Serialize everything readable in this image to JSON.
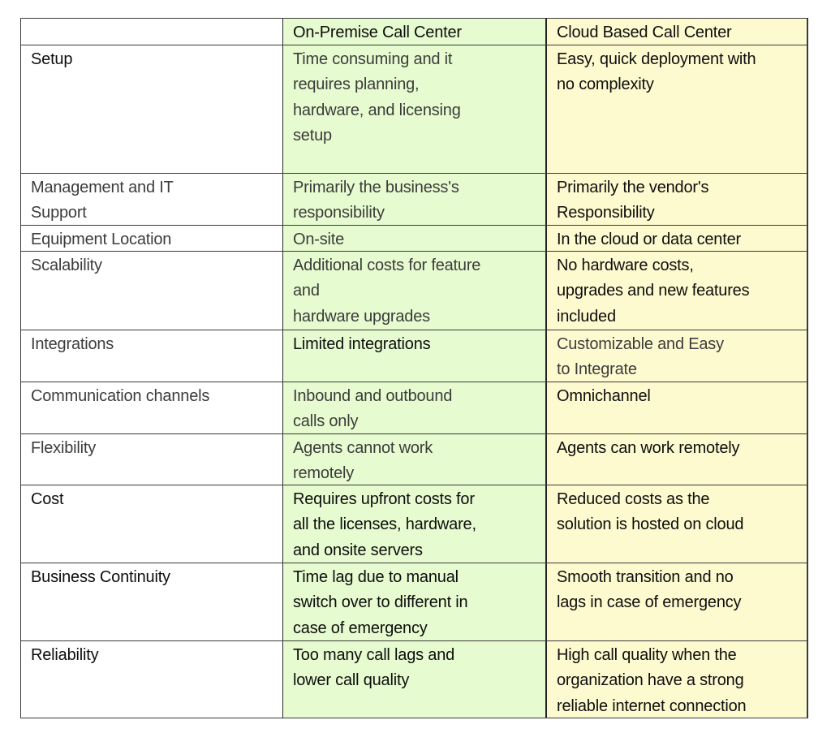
{
  "table": {
    "header": {
      "row_label": "",
      "col1": "On-Premise Call Center",
      "col2": "Cloud Based Call Center"
    },
    "rows": [
      {
        "label": "Setup",
        "on_premise": "Time consuming and it\nrequires planning,\nhardware, and licensing\nsetup",
        "cloud": "Easy, quick deployment with\nno complexity"
      },
      {
        "label": "Management and IT\nSupport",
        "on_premise": "Primarily the business's\nresponsibility",
        "cloud": "Primarily the vendor's\nResponsibility"
      },
      {
        "label": "Equipment Location",
        "on_premise": "On-site",
        "cloud": "In the cloud or data center"
      },
      {
        "label": "Scalability",
        "on_premise": "Additional costs for feature\nand\nhardware upgrades",
        "cloud": "No hardware costs,\nupgrades and new features\nincluded"
      },
      {
        "label": "Integrations",
        "on_premise": "Limited integrations",
        "cloud": "Customizable and Easy\nto Integrate"
      },
      {
        "label": "Communication channels",
        "on_premise": "Inbound and outbound\ncalls only",
        "cloud": "Omnichannel"
      },
      {
        "label": "Flexibility",
        "on_premise": "Agents cannot work\nremotely",
        "cloud": "Agents can work remotely"
      },
      {
        "label": "Cost",
        "on_premise": "Requires upfront costs for\nall the licenses, hardware,\nand onsite servers",
        "cloud": "Reduced costs as the\nsolution is hosted on cloud"
      },
      {
        "label": "Business Continuity",
        "on_premise": "Time lag due to manual\nswitch over to different in\ncase of emergency",
        "cloud": "Smooth transition and no\nlags in case of emergency"
      },
      {
        "label": "Reliability",
        "on_premise": "Too many call lags and\nlower call quality",
        "cloud": "High call quality when the\norganization have a strong\nreliable internet connection"
      }
    ]
  },
  "colors": {
    "on_premise_bg": "#e6fbcf",
    "cloud_bg": "#fefacf",
    "border": "#3a3a3a"
  }
}
